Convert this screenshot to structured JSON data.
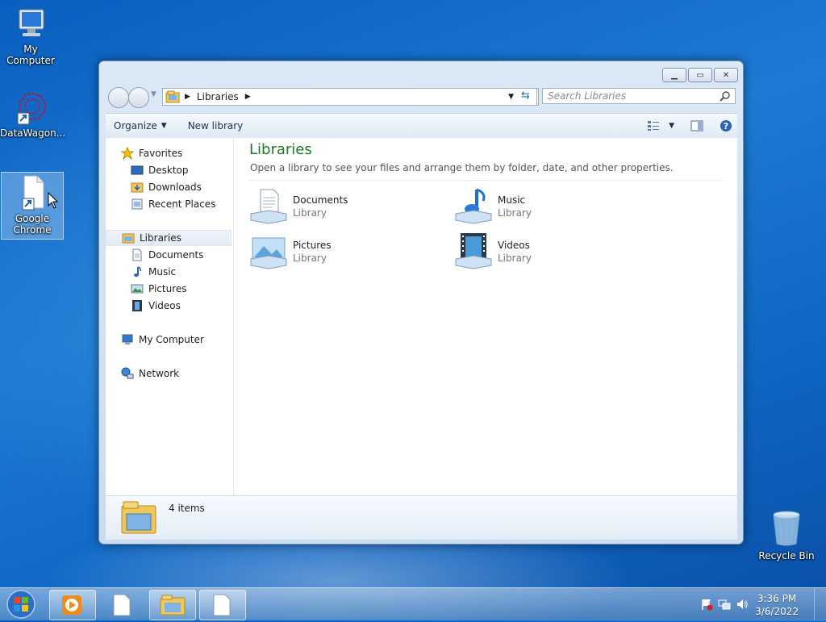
{
  "desktop": {
    "icons": [
      {
        "label": "My Computer",
        "icon": "computer-icon"
      },
      {
        "label": "DataWagon...",
        "icon": "datawagon-icon"
      },
      {
        "label": "Google Chrome",
        "icon": "file-shortcut-icon"
      },
      {
        "label": "Recycle Bin",
        "icon": "recycle-bin-icon"
      }
    ]
  },
  "window": {
    "address": {
      "crumb": "Libraries"
    },
    "search": {
      "placeholder": "Search Libraries"
    },
    "toolbar": {
      "organize_label": "Organize",
      "new_library_label": "New library"
    },
    "navpane": {
      "favorites": {
        "label": "Favorites",
        "items": [
          "Desktop",
          "Downloads",
          "Recent Places"
        ]
      },
      "libraries": {
        "label": "Libraries",
        "items": [
          "Documents",
          "Music",
          "Pictures",
          "Videos"
        ]
      },
      "computer": {
        "label": "My Computer"
      },
      "network": {
        "label": "Network"
      }
    },
    "main": {
      "title": "Libraries",
      "subtitle": "Open a library to see your files and arrange them by folder, date, and other properties.",
      "libraries": [
        {
          "name": "Documents",
          "type": "Library",
          "icon": "documents-library-icon"
        },
        {
          "name": "Music",
          "type": "Library",
          "icon": "music-library-icon"
        },
        {
          "name": "Pictures",
          "type": "Library",
          "icon": "pictures-library-icon"
        },
        {
          "name": "Videos",
          "type": "Library",
          "icon": "videos-library-icon"
        }
      ]
    },
    "details": {
      "count": "4 items"
    }
  },
  "taskbar": {
    "clock": {
      "time": "3:36 PM",
      "date": "3/6/2022"
    }
  },
  "colors": {
    "title_green": "#1e7a2a",
    "desktop_blue": "#1d7ad4"
  }
}
